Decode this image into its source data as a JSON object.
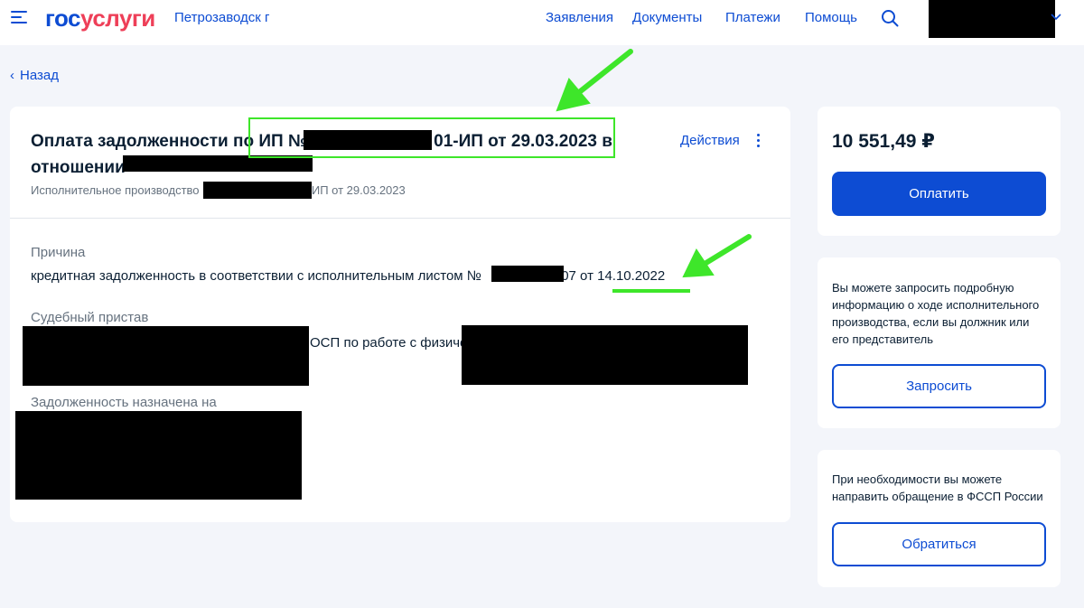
{
  "header": {
    "logo_part1": "гос",
    "logo_part2": "услуги",
    "city": "Петрозаводск г",
    "nav": [
      "Заявления",
      "Документы",
      "Платежи",
      "Помощь"
    ]
  },
  "back_label": "Назад",
  "main": {
    "title_prefix": "Оплата задолженности по ИП №",
    "title_mid": "01-ИП от 29.03.2023 в",
    "title_line2": "отношении",
    "subtitle_prefix": "Исполнительное производство",
    "subtitle_suffix": "-ИП от 29.03.2023",
    "actions_label": "Действия",
    "reason_label": "Причина",
    "reason_prefix": "кредитная задолженность в соответствии с исполнительным листом №",
    "reason_suffix": "507 от 14.10.2022",
    "bailiff_label": "Судебный пристав",
    "bailiff_value": "ОСП по работе с физиче",
    "debt_assigned_label": "Задолженность назначена на"
  },
  "payment": {
    "amount": "10 551,49 ₽",
    "pay_button": "Оплатить"
  },
  "info1": {
    "text": "Вы можете запросить подробную информацию о ходе исполнительного производства, если вы должник или его представитель",
    "button": "Запросить"
  },
  "info2": {
    "text": "При необходимости вы можете направить обращение в ФССП России",
    "button": "Обратиться"
  },
  "colors": {
    "brand_blue": "#0d4cd3",
    "brand_red": "#ee3f58",
    "annotation_green": "#3ee62a"
  }
}
